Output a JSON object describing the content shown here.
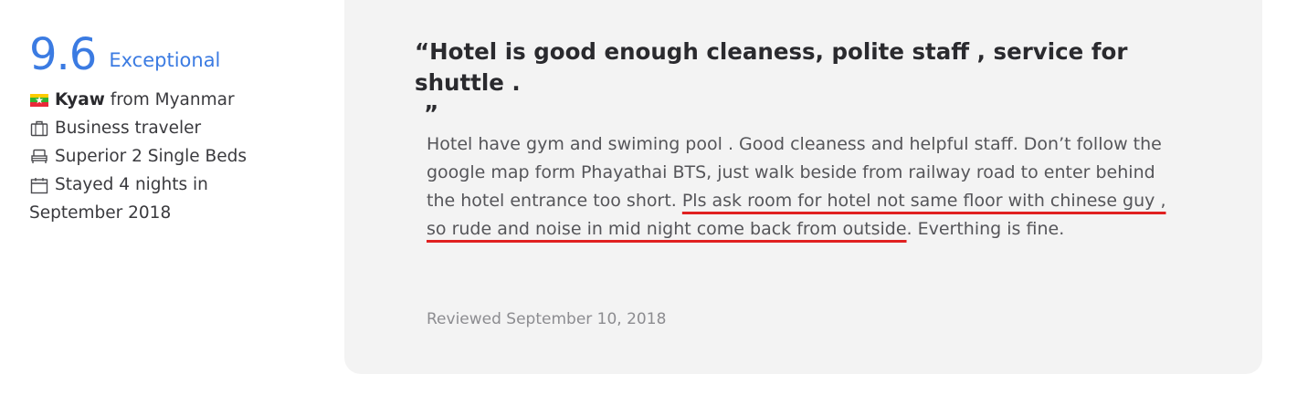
{
  "reviewer": {
    "score": "9.6",
    "score_label": "Exceptional",
    "name": "Kyaw",
    "from_text": "from Myanmar",
    "traveler_type": "Business traveler",
    "room_type": "Superior 2 Single Beds",
    "stay_text": "Stayed 4 nights in September 2018",
    "icons": {
      "flag": "myanmar-flag-icon",
      "traveler": "briefcase-icon",
      "room": "bed-icon",
      "stay": "calendar-icon"
    }
  },
  "review": {
    "quote_open": "“",
    "title": "Hotel is good enough cleaness, polite staff , service for shuttle .",
    "quote_close": "”",
    "body_before": "Hotel have gym and swiming pool . Good cleaness and helpful staff. Don’t follow the google map form Phayathai BTS, just walk beside from railway road to enter behind the hotel entrance too short. ",
    "body_highlight": "Pls ask room for hotel not same floor with chinese guy , so rude and noise in mid night come back from outside",
    "body_after": ". Everthing is fine.",
    "reviewed_date": "Reviewed September 10, 2018"
  },
  "colors": {
    "score": "#3b7be2",
    "card_background": "#f3f3f3",
    "annotation_underline": "#e02020",
    "flag_yellow": "#fecb00",
    "flag_green": "#34b233",
    "flag_red": "#ea2839"
  }
}
